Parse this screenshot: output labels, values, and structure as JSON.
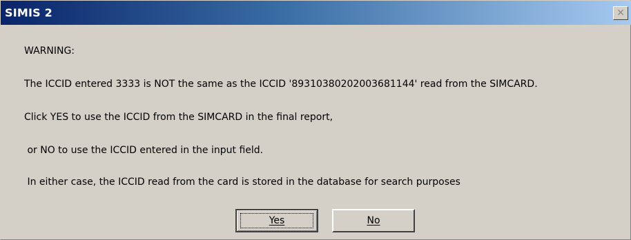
{
  "window": {
    "title": "SIMIS 2",
    "close_glyph": "✕"
  },
  "message": {
    "heading": "WARNING:",
    "line1": "The ICCID entered 3333 is NOT the same as the ICCID '89310380202003681144' read from the SIMCARD.",
    "line2": "Click YES to use the ICCID from the SIMCARD in the final report,",
    "line3": " or NO to use the ICCID entered in the input field.",
    "line4": " In either case, the ICCID read from the card is stored in the database for search purposes"
  },
  "buttons": {
    "yes_label": "Yes",
    "no_label": "No"
  }
}
